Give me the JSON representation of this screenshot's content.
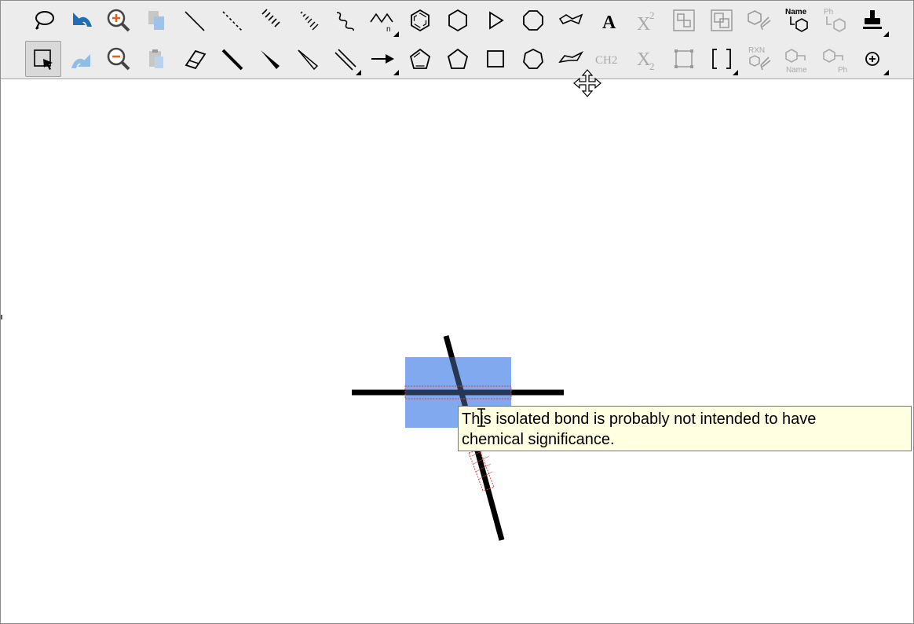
{
  "toolbar": {
    "text_tool_label": "A",
    "superscript_label": "X",
    "superscript_exp": "2",
    "subscript_label": "X",
    "subscript_index": "2",
    "ch2_label": "CH2",
    "name_label": "Name",
    "ph_label": "Ph",
    "rxn_label": "RXN",
    "repeat_n": "n",
    "icons": {
      "row1": [
        "lasso-icon",
        "undo-icon",
        "zoom-in-icon",
        "copy-icon",
        "single-bond-icon",
        "dashed-bond-icon",
        "hashed-bond-icon",
        "hashed-wedge-bond-icon",
        "wavy-bond-icon",
        "chain-icon",
        "benzene-icon",
        "cyclohexane-icon",
        "cyclopropane-icon",
        "cyclooctane-icon",
        "cyclohexane-chair-icon",
        "text-icon",
        "superscript-icon",
        "group-icon",
        "ungroup-icon",
        "clean-structure-icon",
        "structure-to-name-icon",
        "expand-label-icon",
        "stamp-icon"
      ],
      "row2": [
        "select-icon",
        "redo-icon",
        "zoom-out-icon",
        "paste-icon",
        "eraser-icon",
        "bold-bond-icon",
        "wedge-bond-icon",
        "hollow-wedge-bond-icon",
        "double-bond-icon",
        "arrow-icon",
        "cyclopentadiene-icon",
        "cyclopentane-icon",
        "cyclobutane-icon",
        "cycloheptane-icon",
        "cyclohexane-chair-2-icon",
        "ch2-icon",
        "subscript-icon",
        "group-2-icon",
        "brackets-icon",
        "clean-reaction-icon",
        "name-to-structure-icon",
        "contract-label-icon",
        "charge-plus-icon"
      ]
    }
  },
  "canvas": {
    "tooltip_line1": "This isolated bond is probably not intended to have",
    "tooltip_line2": "chemical significance."
  },
  "colors": {
    "toolbar_bg": "#ececec",
    "selection": "#6f9fef",
    "accent_blue": "#1f6fb5",
    "warning_red": "#e23b3b",
    "tooltip_bg": "#ffffe1"
  }
}
